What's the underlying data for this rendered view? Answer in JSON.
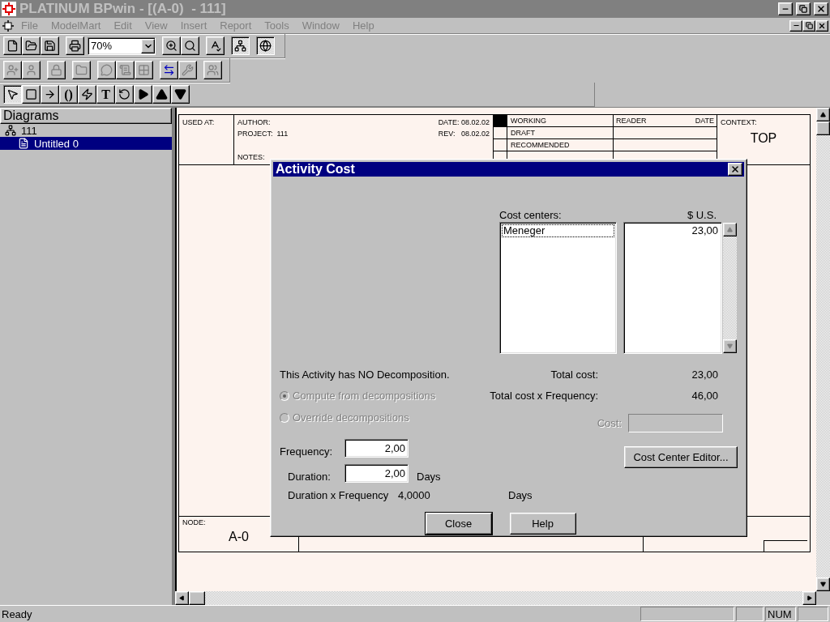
{
  "window": {
    "title": "PLATINUM BPwin - [(A-0)  - 111]"
  },
  "menu": [
    "File",
    "ModelMart",
    "Edit",
    "View",
    "Insert",
    "Report",
    "Tools",
    "Window",
    "Help"
  ],
  "toolbars": [
    [
      {
        "kind": "new"
      },
      {
        "kind": "open"
      },
      {
        "kind": "save"
      },
      {
        "kind": "gap"
      },
      {
        "kind": "print"
      },
      {
        "kind": "combo",
        "value": "70%"
      },
      {
        "kind": "zoom-in"
      },
      {
        "kind": "zoom-fit"
      },
      {
        "kind": "gap"
      },
      {
        "kind": "spell"
      },
      {
        "kind": "gap"
      },
      {
        "kind": "tree",
        "selected": true
      },
      {
        "kind": "gap"
      },
      {
        "kind": "globe",
        "selected": true
      }
    ],
    [
      {
        "kind": "head-plus",
        "disabled": true
      },
      {
        "kind": "head",
        "disabled": true
      },
      {
        "kind": "gap"
      },
      {
        "kind": "lock",
        "disabled": true
      },
      {
        "kind": "gap"
      },
      {
        "kind": "folder",
        "disabled": true
      },
      {
        "kind": "gap"
      },
      {
        "kind": "bubble",
        "disabled": true
      },
      {
        "kind": "script",
        "disabled": true
      },
      {
        "kind": "grid",
        "disabled": true
      },
      {
        "kind": "gap"
      },
      {
        "kind": "exchange",
        "disabled": false
      },
      {
        "kind": "wrench",
        "disabled": true
      },
      {
        "kind": "gap"
      },
      {
        "kind": "people",
        "disabled": true
      }
    ],
    [
      {
        "kind": "pointer",
        "selected": true
      },
      {
        "kind": "box",
        "selected": false
      },
      {
        "kind": "arrow",
        "selected": false
      },
      {
        "kind": "glyph",
        "label": "()",
        "selected": false
      },
      {
        "kind": "squiggle",
        "selected": false
      },
      {
        "kind": "glyph",
        "label": "T",
        "selected": false
      },
      {
        "kind": "rotate",
        "selected": false
      },
      {
        "kind": "play",
        "selected": false
      },
      {
        "kind": "up",
        "selected": false
      },
      {
        "kind": "down",
        "selected": false
      }
    ]
  ],
  "diagrams_panel": {
    "title": "Diagrams",
    "tree": [
      {
        "label": "111",
        "selected": false,
        "children": [
          {
            "label": "Untitled 0",
            "selected": true
          }
        ]
      }
    ]
  },
  "diagram": {
    "used_at": "USED AT:",
    "author": "AUTHOR:",
    "project": "PROJECT:  111",
    "date": "DATE: 08.02.02",
    "rev": "REV:   08.02.02",
    "notes": "NOTES:",
    "statuses": [
      {
        "label": "WORKING",
        "selected": true
      },
      {
        "label": "DRAFT",
        "selected": false
      },
      {
        "label": "RECOMMENDED",
        "selected": false
      }
    ],
    "reader": "READER",
    "reader_date": "DATE",
    "context": "CONTEXT:",
    "context_value": "TOP",
    "node": "NODE:",
    "node_value": "A-0"
  },
  "dialog": {
    "title": "Activity Cost",
    "cost_centers_label": "Cost centers:",
    "currency": "$ U.S.",
    "cost_centers": [
      {
        "name": "Meneger",
        "value": "23,00",
        "selected": true
      }
    ],
    "decomposition_note": "This Activity has NO Decomposition.",
    "total_cost_label": "Total cost:",
    "total_cost": "23,00",
    "total_freq_label": "Total cost x Frequency:",
    "total_freq": "46,00",
    "options": [
      {
        "label": "Compute from decompositions",
        "selected": true,
        "disabled": true
      },
      {
        "label": "Override decompositions",
        "selected": false,
        "disabled": true
      }
    ],
    "cost_label": "Cost:",
    "cost_disabled": true,
    "frequency_label": "Frequency:",
    "frequency": "2,00",
    "duration_label": "Duration:",
    "duration": "2,00",
    "duration_unit": "Days",
    "dxf_label": "Duration x Frequency",
    "dxf_value": "4,0000",
    "dxf_unit": "Days",
    "editor_button": "Cost Center Editor...",
    "buttons": [
      "Close",
      "Help"
    ]
  },
  "status_bar": {
    "message": "Ready",
    "indicators": [
      "NUM"
    ]
  }
}
